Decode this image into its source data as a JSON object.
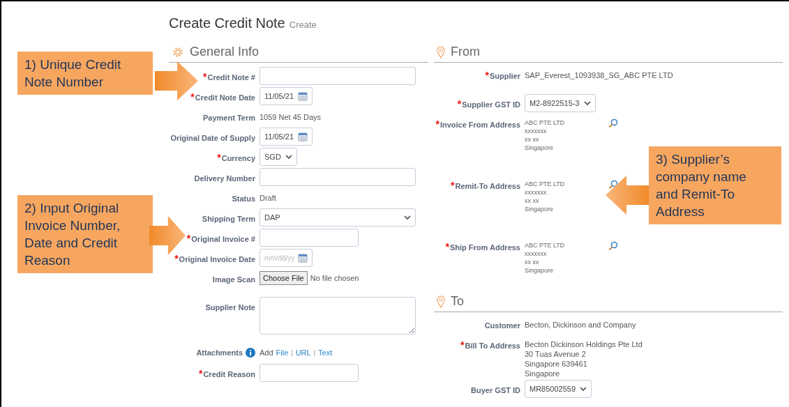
{
  "page": {
    "title": "Create Credit Note",
    "subtitle": "Create"
  },
  "general_info": {
    "heading": "General Info",
    "fields": [
      {
        "kind": "wide_input",
        "mark": "*",
        "label": "Credit Note #"
      },
      {
        "kind": "date",
        "mark": "*",
        "label": "Credit Note Date",
        "value": "11/05/21"
      },
      {
        "kind": "text",
        "label": "Payment Term",
        "value": "1059 Net 45 Days"
      },
      {
        "kind": "date",
        "label": "Original Date of Supply",
        "value": "11/05/21"
      },
      {
        "kind": "select",
        "mark": "*",
        "label": "Currency",
        "value": "SGD"
      },
      {
        "kind": "wide_input",
        "label": "Delivery Number"
      },
      {
        "kind": "text",
        "label": "Status",
        "value": "Draft"
      },
      {
        "kind": "wide_select",
        "label": "Shipping Term",
        "value": "DAP"
      },
      {
        "kind": "input",
        "mark": "*",
        "label": "Original Invoice #"
      },
      {
        "kind": "date",
        "mark": "*",
        "label": "Original Invoice Date",
        "placeholder": "mm/dd/yy"
      },
      {
        "kind": "file",
        "label": "Image Scan",
        "button": "Choose File",
        "value": "No file chosen"
      },
      {
        "kind": "textarea",
        "label": "Supplier Note"
      },
      {
        "kind": "attachments",
        "label": "Attachments",
        "prefix": "Add",
        "links": [
          "File",
          "URL",
          "Text"
        ],
        "separator": "|"
      },
      {
        "kind": "input",
        "mark": "*",
        "label": "Credit Reason"
      }
    ]
  },
  "from": {
    "heading": "From",
    "fields": [
      {
        "kind": "text",
        "mark": "*",
        "label": "Supplier",
        "value": "SAP_Everest_1093938_SG_ABC PTE LTD"
      },
      {
        "kind": "select",
        "mark": "*",
        "label": "Supplier GST ID",
        "value": "M2-8922515-3"
      },
      {
        "kind": "address",
        "mark": "*",
        "label": "Invoice From Address",
        "lines": [
          "ABC PTE LTD",
          "xxxxxxx",
          "xx xx",
          "Singapore"
        ]
      },
      {
        "kind": "address",
        "mark": "*",
        "label": "Remit-To Address",
        "lines": [
          "ABC PTE LTD",
          "xxxxxxx",
          "xx xx",
          "Singapore"
        ]
      },
      {
        "kind": "address",
        "mark": "*",
        "label": "Ship From Address",
        "lines": [
          "ABC PTE LTD",
          "xxxxxxx",
          "xx xx",
          "Singapore"
        ]
      }
    ]
  },
  "to": {
    "heading": "To",
    "fields": [
      {
        "kind": "text",
        "label": "Customer",
        "value": "Becton, Dickinson and Company"
      },
      {
        "kind": "lines",
        "mark": "*",
        "label": "Bill To Address",
        "lines": [
          "Becton Dickinson Holdings Pte Ltd",
          "30 Tuas Avenue 2",
          "Singapore 639461",
          "Singapore"
        ]
      },
      {
        "kind": "select",
        "label": "Buyer GST ID",
        "value": "MR85002559"
      }
    ]
  },
  "callouts": [
    {
      "text": "1) Unique Credit Note Number",
      "kind": "right"
    },
    {
      "text": "2) Input Original Invoice Number, Date and Credit Reason",
      "kind": "right"
    },
    {
      "text": "3) Supplier’s company name and Remit-To Address",
      "kind": "left"
    }
  ]
}
